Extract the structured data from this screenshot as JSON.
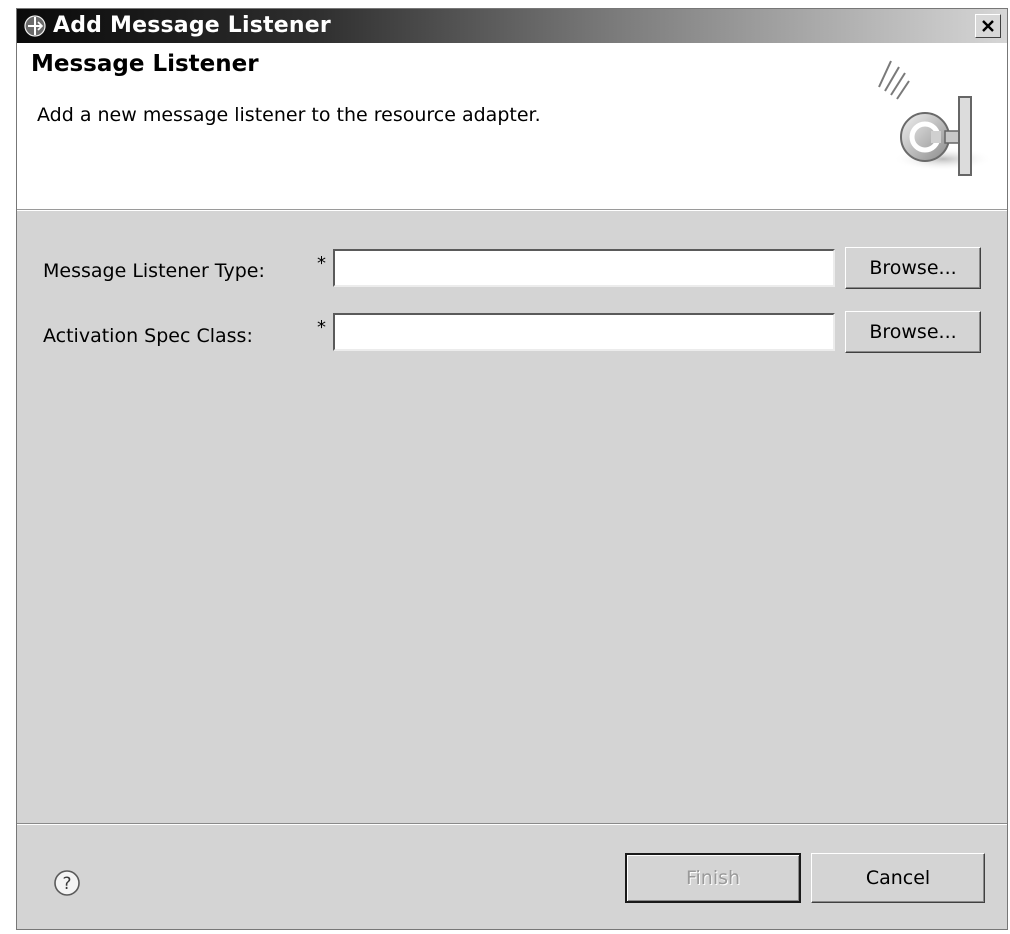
{
  "window": {
    "title": "Add Message Listener",
    "close_icon": "close-icon",
    "app_icon": "plugin-icon"
  },
  "header": {
    "title": "Message Listener",
    "description": "Add a new message listener to the resource adapter.",
    "graphic_icon": "connector-wizard-icon"
  },
  "form": {
    "fields": [
      {
        "label": "Message Listener Type:",
        "required_marker": "*",
        "value": "",
        "browse_label": "Browse..."
      },
      {
        "label": "Activation Spec Class:",
        "required_marker": "*",
        "value": "",
        "browse_label": "Browse..."
      }
    ]
  },
  "footer": {
    "help_icon": "help-icon",
    "finish_label": "Finish",
    "finish_enabled": false,
    "cancel_label": "Cancel"
  }
}
